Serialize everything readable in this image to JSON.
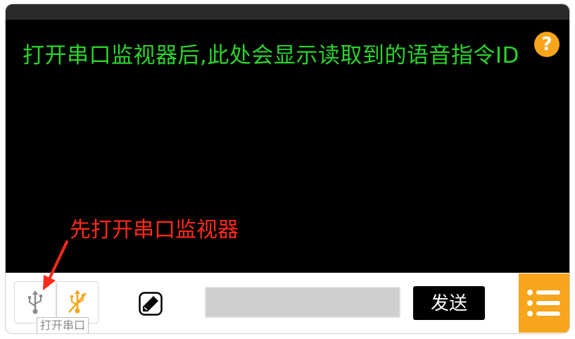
{
  "monitor": {
    "placeholder_text": "打开串口监视器后,此处会显示读取到的语音指令ID",
    "help_symbol": "?"
  },
  "annotation": {
    "text": "先打开串口监视器"
  },
  "toolbar": {
    "open_port_tooltip": "打开串口",
    "send_input_value": "",
    "send_label": "发送"
  },
  "icons": {
    "help": "question-icon",
    "open_port": "usb-icon",
    "close_port": "usb-off-icon",
    "clear": "eraser-icon",
    "menu": "list-menu-icon",
    "arrow": "red-arrow-icon"
  },
  "colors": {
    "monitor_bg": "#000000",
    "monitor_text": "#2bd32b",
    "accent": "#f7a51b",
    "annotation": "#ff2a1a",
    "send_button": "#000000"
  }
}
